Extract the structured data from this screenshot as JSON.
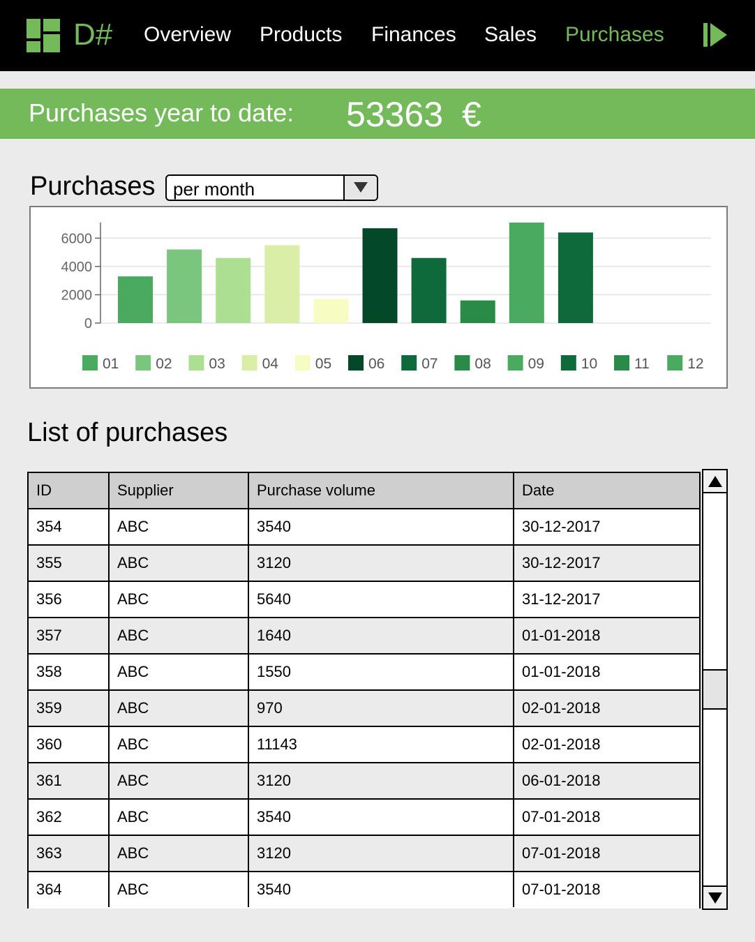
{
  "app": {
    "brand": "D#",
    "nav": [
      {
        "label": "Overview",
        "active": false
      },
      {
        "label": "Products",
        "active": false
      },
      {
        "label": "Finances",
        "active": false
      },
      {
        "label": "Sales",
        "active": false
      },
      {
        "label": "Purchases",
        "active": true
      }
    ],
    "nav_icons": [
      "grid-logo-icon",
      "play-icon"
    ]
  },
  "banner": {
    "label": "Purchases year to date:",
    "value": "53363",
    "currency": "€"
  },
  "chart_section": {
    "title": "Purchases",
    "period_select": {
      "value": "per month",
      "icon": "dropdown-triangle-icon"
    }
  },
  "chart_data": {
    "type": "bar",
    "categories": [
      "01",
      "02",
      "03",
      "04",
      "05",
      "06",
      "07",
      "08",
      "09",
      "10",
      "11",
      "12"
    ],
    "values": [
      3300,
      5200,
      4600,
      5500,
      1700,
      6700,
      4600,
      1600,
      7100,
      6400,
      null,
      null
    ],
    "colors": [
      "#4aaa5f",
      "#7ac67f",
      "#addf93",
      "#daeea7",
      "#f7fcc3",
      "#04482a",
      "#0e6a3a",
      "#2a8a48",
      "#4aaa5f",
      "#0e6a3a",
      "#2a8a48",
      "#4aaa5f"
    ],
    "ylim": [
      0,
      7100
    ],
    "yticks": [
      "0",
      "2000",
      "4000",
      "6000"
    ],
    "ytick_values": [
      0,
      2000,
      4000,
      6000
    ],
    "grid": true,
    "legend": "bottom",
    "xlabel": "",
    "ylabel": "",
    "title": ""
  },
  "list": {
    "title": "List of purchases",
    "columns": [
      "ID",
      "Supplier",
      "Purchase volume",
      "Date"
    ],
    "rows": [
      [
        "354",
        "ABC",
        "3540",
        "30-12-2017"
      ],
      [
        "355",
        "ABC",
        "3120",
        "30-12-2017"
      ],
      [
        "356",
        "ABC",
        "5640",
        "31-12-2017"
      ],
      [
        "357",
        "ABC",
        "1640",
        "01-01-2018"
      ],
      [
        "358",
        "ABC",
        "1550",
        "01-01-2018"
      ],
      [
        "359",
        "ABC",
        "970",
        "02-01-2018"
      ],
      [
        "360",
        "ABC",
        "11143",
        "02-01-2018"
      ],
      [
        "361",
        "ABC",
        "3120",
        "06-01-2018"
      ],
      [
        "362",
        "ABC",
        "3540",
        "07-01-2018"
      ],
      [
        "363",
        "ABC",
        "3120",
        "07-01-2018"
      ],
      [
        "364",
        "ABC",
        "3540",
        "07-01-2018"
      ]
    ],
    "scroll_icons": [
      "scroll-up-arrow-icon",
      "scroll-down-arrow-icon"
    ]
  }
}
